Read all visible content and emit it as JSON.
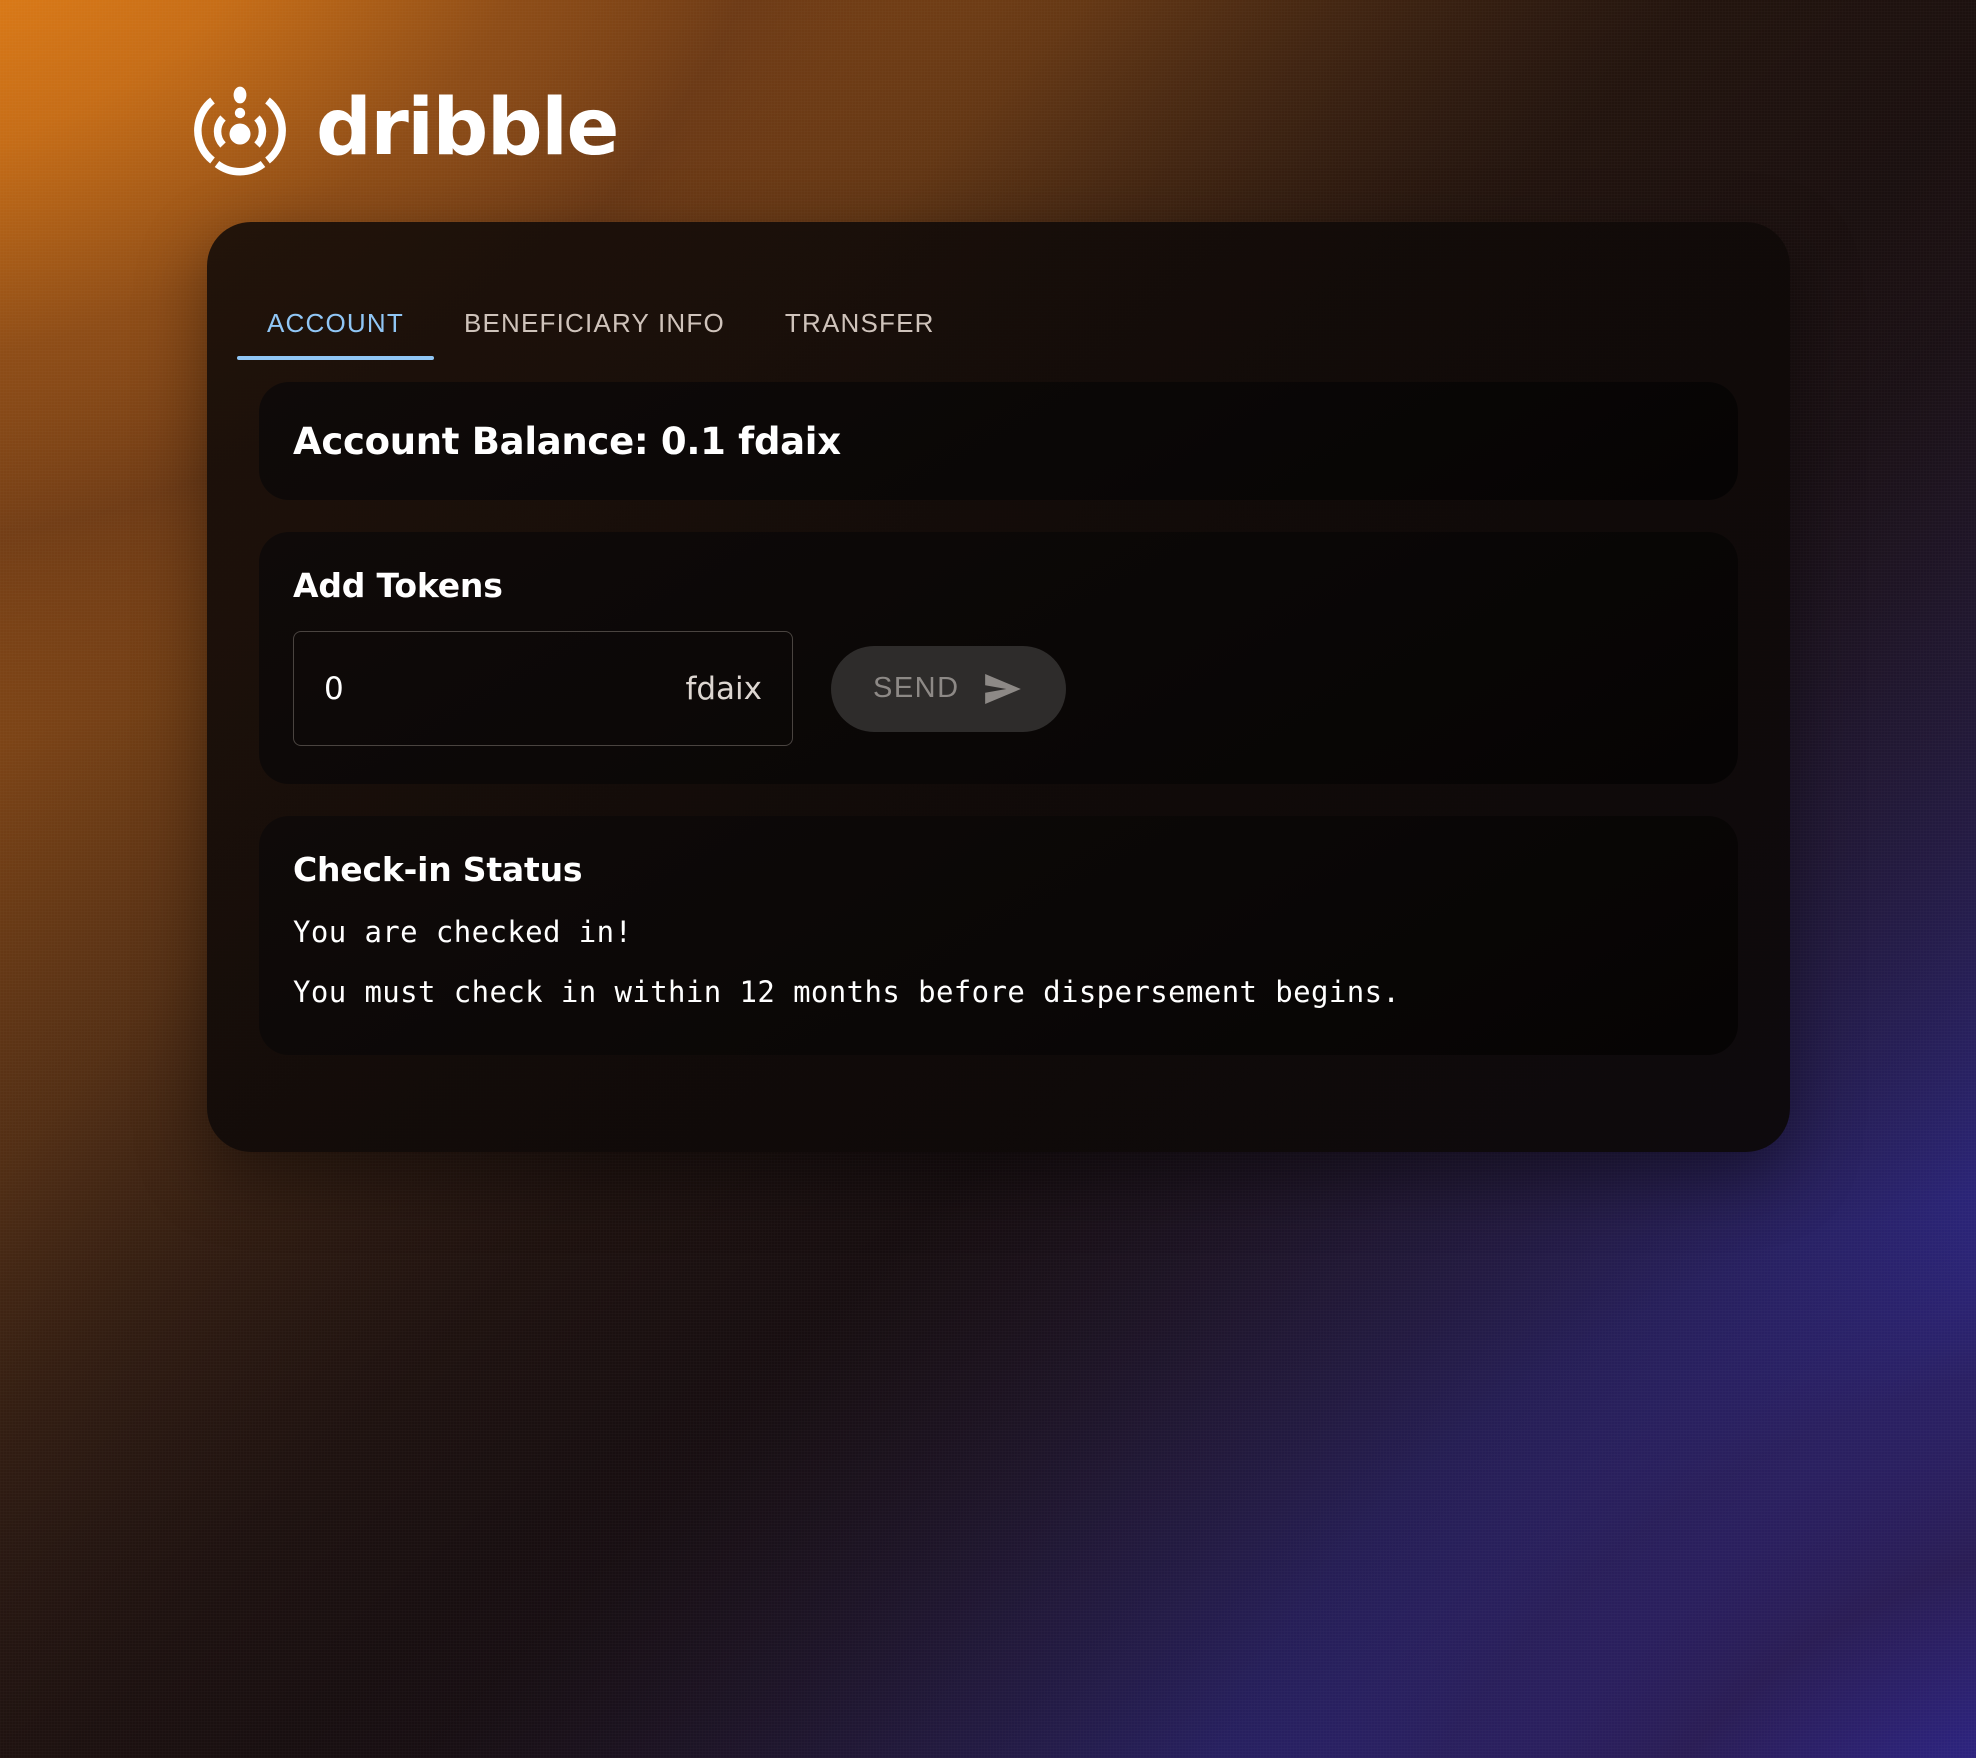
{
  "brand": {
    "name": "dribble",
    "logo_icon": "dribble-circular-droplet-logo"
  },
  "colors": {
    "accent_blue": "#90c6f5",
    "bg_orange": "#f08a18",
    "bg_blue": "#2f2ec0",
    "card_bg": "#120b08",
    "panel_bg": "#0a0706",
    "send_button_bg": "#2e2c2b",
    "send_button_text": "#8d8986"
  },
  "tabs": [
    {
      "label": "ACCOUNT",
      "active": true
    },
    {
      "label": "BENEFICIARY INFO",
      "active": false
    },
    {
      "label": "TRANSFER",
      "active": false
    }
  ],
  "balance": {
    "text": "Account Balance: 0.1 fdaix",
    "label": "Account Balance:",
    "amount": "0.1",
    "token": "fdaix"
  },
  "add_tokens": {
    "title": "Add Tokens",
    "input_value": "0",
    "input_placeholder": "0",
    "suffix": "fdaix",
    "send_label": "SEND",
    "send_icon": "send-paper-plane-icon"
  },
  "check_in": {
    "title": "Check-in Status",
    "line1": "You are checked in!",
    "line2": "You must check in within 12 months before dispersement begins."
  }
}
